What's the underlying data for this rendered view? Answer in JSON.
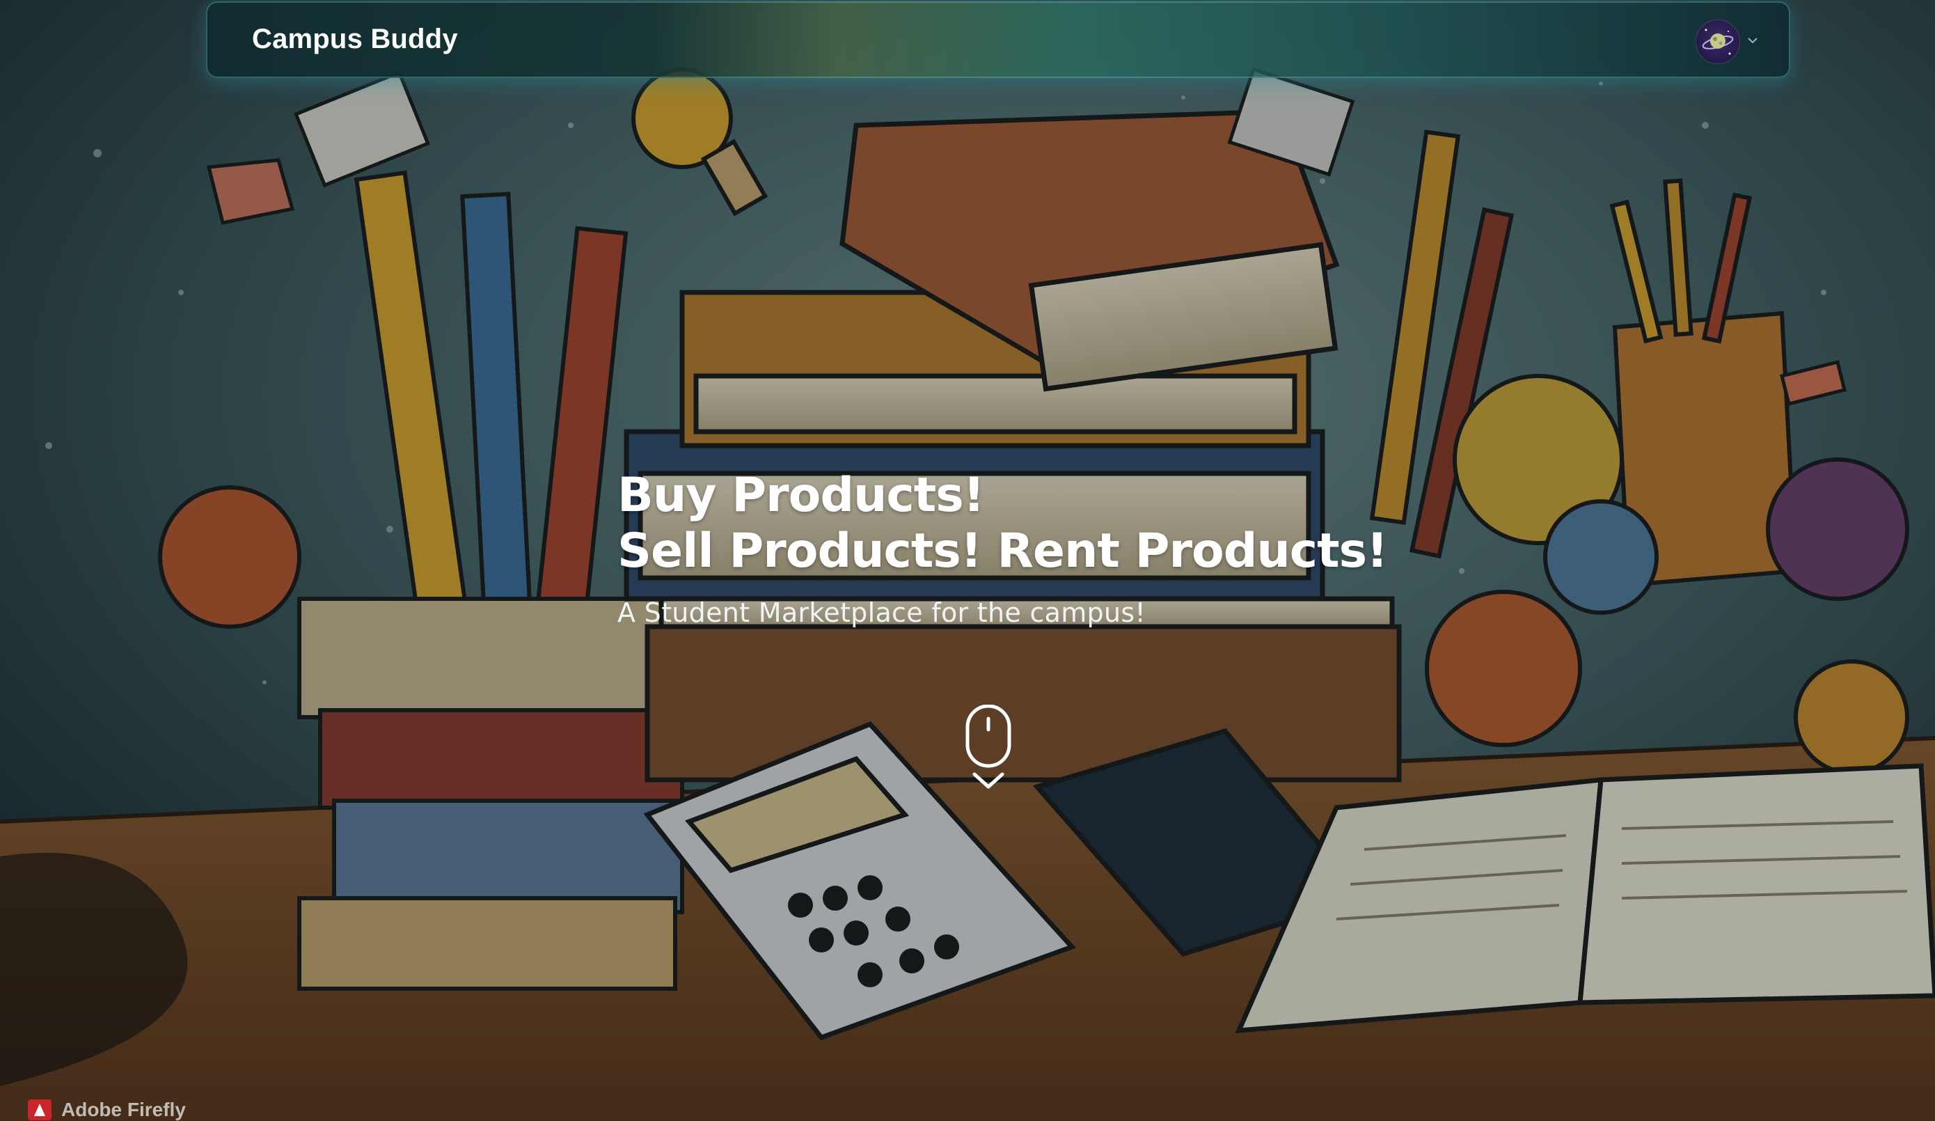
{
  "navbar": {
    "brand": "Campus Buddy",
    "avatar_icon": "planet-avatar-icon",
    "menu_icon": "chevron-down-icon"
  },
  "hero": {
    "headline_line1": "Buy Products!",
    "headline_line2": "Sell Products! Rent Products!",
    "subheading": "A Student Marketplace for the campus!",
    "scroll_icon": "mouse-scroll-icon",
    "scroll_arrow_icon": "chevron-down-icon"
  },
  "watermark": {
    "text": "Adobe Firefly"
  },
  "colors": {
    "navbar_bg": "#123034",
    "text": "#ffffff",
    "accent_glow": "#2a8ca0",
    "avatar_bg": "#2a1d52"
  }
}
